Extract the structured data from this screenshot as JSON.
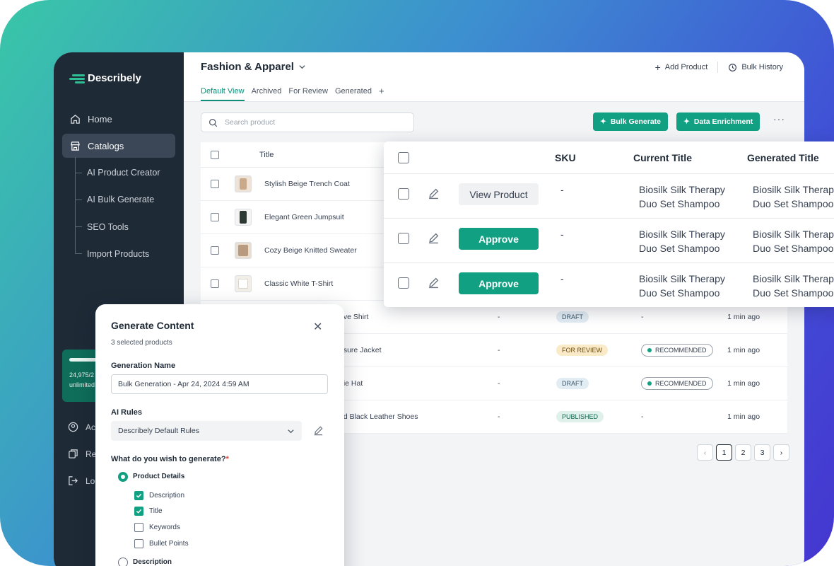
{
  "brand": {
    "name": "Describely",
    "accent": "#12a083"
  },
  "sidebar": {
    "items": [
      {
        "label": "Home",
        "icon": "home-icon"
      },
      {
        "label": "Catalogs",
        "icon": "store-icon"
      }
    ],
    "subitems": [
      "AI Product Creator",
      "AI Bulk Generate",
      "SEO Tools",
      "Import Products"
    ],
    "usage": {
      "line1": "24,975/2",
      "line2": "unlimited"
    },
    "bottom": [
      {
        "label": "Ac",
        "icon": "account-icon"
      },
      {
        "label": "Re",
        "icon": "copy-icon"
      },
      {
        "label": "Lo",
        "icon": "logout-icon"
      }
    ]
  },
  "header": {
    "catalog": "Fashion & Apparel",
    "add_product": "Add Product",
    "bulk_history": "Bulk History",
    "tabs": [
      "Default View",
      "Archived",
      "For Review",
      "Generated",
      "+"
    ]
  },
  "toolbar": {
    "search_placeholder": "Search product",
    "bulk_generate": "Bulk Generate",
    "data_enrichment": "Data Enrichment",
    "more": "···"
  },
  "table": {
    "title_header": "Title",
    "rows": [
      {
        "title": "Stylish Beige Trench Coat"
      },
      {
        "title": "Elegant Green Jumpsuit"
      },
      {
        "title": "Cozy Beige Knitted Sweater"
      },
      {
        "title": "Classic White T-Shirt"
      },
      {
        "title": "eve Shirt",
        "sku": "-",
        "status": "DRAFT",
        "rec": "-",
        "time": "1 min ago"
      },
      {
        "title": "osure Jacket",
        "sku": "-",
        "status": "FOR REVIEW",
        "rec": "RECOMMENDED",
        "time": "1 min ago"
      },
      {
        "title": "nie Hat",
        "sku": "-",
        "status": "DRAFT",
        "rec": "RECOMMENDED",
        "time": "1 min ago"
      },
      {
        "title": "nd Black Leather Shoes",
        "sku": "-",
        "status": "PUBLISHED",
        "rec": "-",
        "time": "1 min ago"
      }
    ]
  },
  "pagination": {
    "pages": [
      "1",
      "2",
      "3"
    ],
    "prev": "‹",
    "next": "›"
  },
  "overlay": {
    "headers": {
      "sku": "SKU",
      "current": "Current Title",
      "generated": "Generated Title"
    },
    "rows": [
      {
        "action": "View Product",
        "sku": "-",
        "current1": "Biosilk Silk Therapy",
        "current2": "Duo Set Shampoo",
        "gen1": "Biosilk Silk Therap",
        "gen2": "Duo Set Shampoo"
      },
      {
        "action": "Approve",
        "sku": "-",
        "current1": "Biosilk Silk Therapy",
        "current2": "Duo Set Shampoo",
        "gen1": "Biosilk Silk Therap",
        "gen2": "Duo Set Shampoo"
      },
      {
        "action": "Approve",
        "sku": "-",
        "current1": "Biosilk Silk Therapy",
        "current2": "Duo Set Shampoo",
        "gen1": "Biosilk Silk Therap",
        "gen2": "Duo Set Shampoo"
      }
    ]
  },
  "modal": {
    "title": "Generate Content",
    "subtitle": "3 selected products",
    "gen_name_label": "Generation Name",
    "gen_name_value": "Bulk Generation - Apr 24, 2024 4:59 AM",
    "ai_rules_label": "AI Rules",
    "ai_rules_value": "Describely Default Rules",
    "question": "What do you wish to generate?",
    "required": "*",
    "product_details": "Product Details",
    "options": [
      {
        "label": "Description",
        "checked": true
      },
      {
        "label": "Title",
        "checked": true
      },
      {
        "label": "Keywords",
        "checked": false
      },
      {
        "label": "Bullet Points",
        "checked": false
      }
    ],
    "description_option": "Description"
  }
}
